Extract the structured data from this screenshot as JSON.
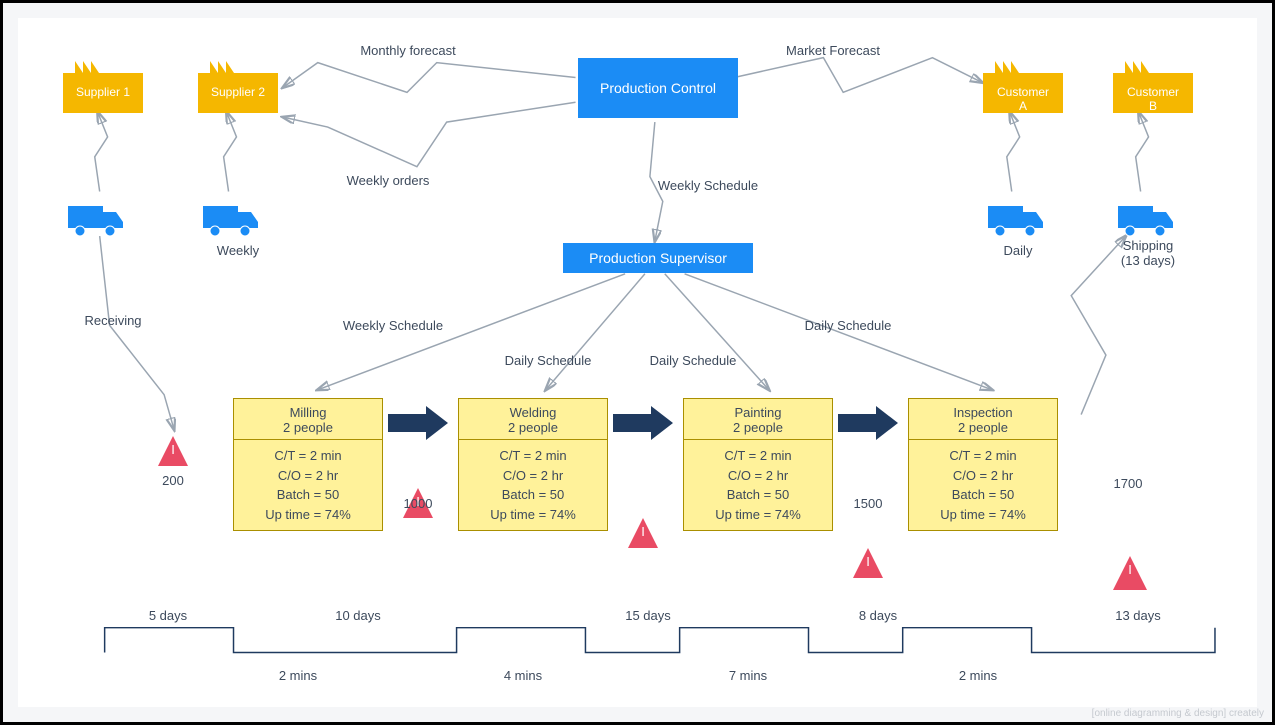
{
  "entities": {
    "supplier1": "Supplier 1",
    "supplier2": "Supplier 2",
    "customerA": "Customer\nA",
    "customerB": "Customer\nB",
    "productionControl": "Production Control",
    "productionSupervisor": "Production Supervisor"
  },
  "flows": {
    "monthlyForecast": "Monthly forecast",
    "marketForecast": "Market Forecast",
    "weeklyOrders": "Weekly orders",
    "weeklySchedule": "Weekly Schedule",
    "weeklySchedule2": "Weekly Schedule",
    "dailySchedule1": "Daily Schedule",
    "dailySchedule2": "Daily Schedule",
    "dailySchedule3": "Daily Schedule",
    "receiving": "Receiving",
    "weekly": "Weekly",
    "daily": "Daily",
    "shipping": "Shipping\n(13 days)"
  },
  "processes": {
    "milling": {
      "title": "Milling",
      "people": "2 people",
      "ct": "C/T = 2 min",
      "co": "C/O = 2 hr",
      "batch": "Batch = 50",
      "up": "Up time = 74%"
    },
    "welding": {
      "title": "Welding",
      "people": "2 people",
      "ct": "C/T = 2 min",
      "co": "C/O = 2 hr",
      "batch": "Batch = 50",
      "up": "Up time = 74%"
    },
    "painting": {
      "title": "Painting",
      "people": "2 people",
      "ct": "C/T = 2 min",
      "co": "C/O = 2 hr",
      "batch": "Batch = 50",
      "up": "Up time = 74%"
    },
    "inspection": {
      "title": "Inspection",
      "people": "2 people",
      "ct": "C/T = 2 min",
      "co": "C/O = 2 hr",
      "batch": "Batch = 50",
      "up": "Up time = 74%"
    }
  },
  "inventory": {
    "i1": "I",
    "i2": "I",
    "i3": "I",
    "i4": "I",
    "i5": "I",
    "q1": "200",
    "q2": "1000",
    "q3": "1500",
    "q4": "1700"
  },
  "timeline": {
    "d1": "5 days",
    "d2": "10 days",
    "d3": "15 days",
    "d4": "8 days",
    "d5": "13 days",
    "m1": "2 mins",
    "m2": "4 mins",
    "m3": "7 mins",
    "m4": "2 mins"
  },
  "watermark": "[online diagramming & design]  creately"
}
